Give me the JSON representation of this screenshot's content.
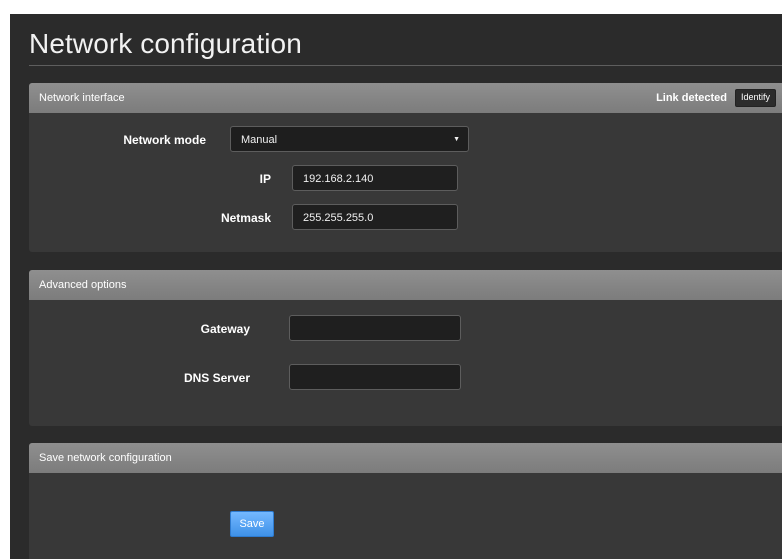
{
  "page": {
    "title": "Network configuration"
  },
  "network_interface": {
    "header": "Network interface",
    "link_status": "Link detected",
    "identify_label": "Identify",
    "mode": {
      "label": "Network mode",
      "value": "Manual",
      "caret": "▼"
    },
    "ip": {
      "label": "IP",
      "value": "192.168.2.140"
    },
    "netmask": {
      "label": "Netmask",
      "value": "255.255.255.0"
    }
  },
  "advanced": {
    "header": "Advanced options",
    "gateway": {
      "label": "Gateway",
      "value": ""
    },
    "dns": {
      "label": "DNS Server",
      "value": ""
    }
  },
  "save_section": {
    "header": "Save network configuration",
    "save_label": "Save"
  },
  "colors": {
    "background": "#2b2b2b",
    "panel": "#383838",
    "panel_header": "#858585",
    "button_primary": "#4d9cf0"
  }
}
